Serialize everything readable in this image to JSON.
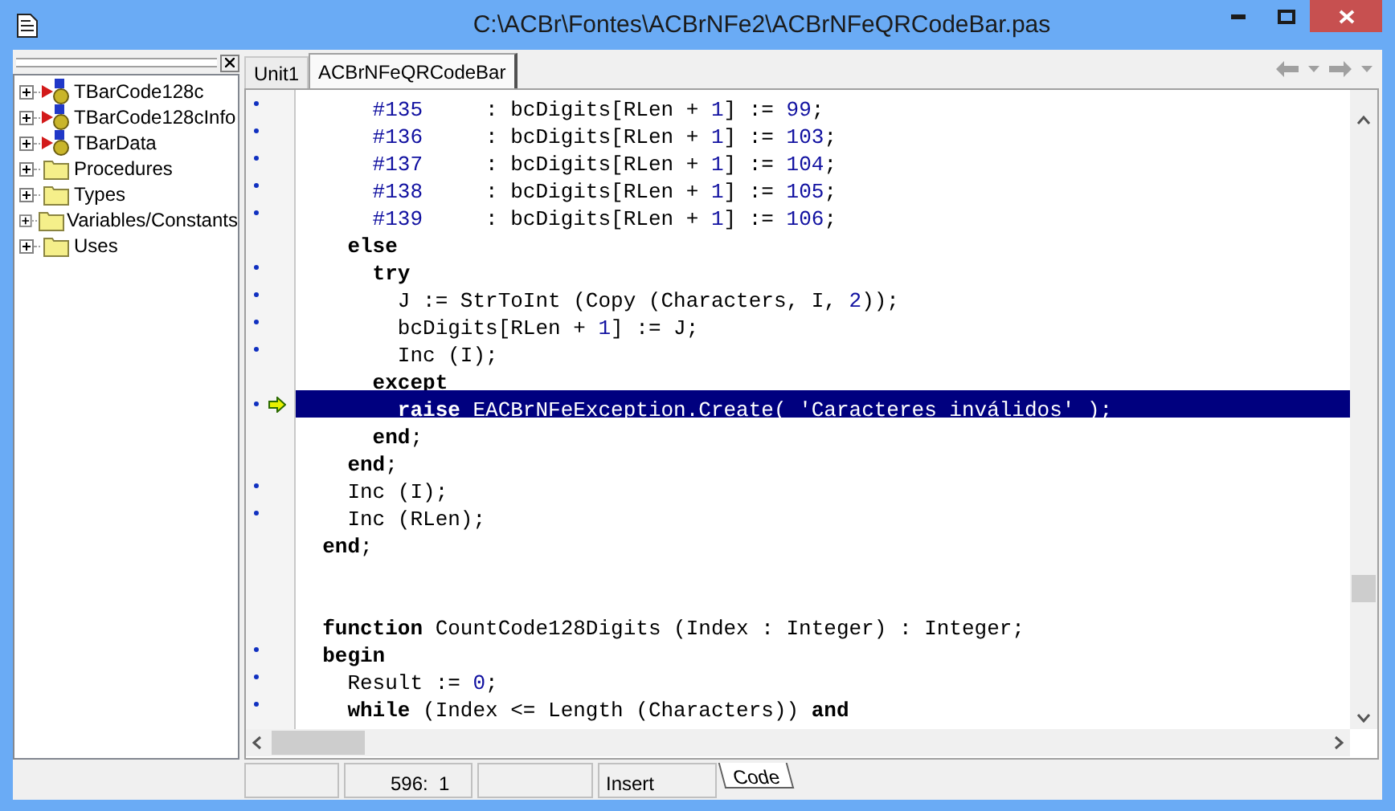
{
  "window": {
    "title": "C:\\ACBr\\Fontes\\ACBrNFe2\\ACBrNFeQRCodeBar.pas"
  },
  "explorer": {
    "items": [
      {
        "label": "TBarCode128c",
        "kind": "class",
        "expanded": false
      },
      {
        "label": "TBarCode128cInfo",
        "kind": "class",
        "expanded": false
      },
      {
        "label": "TBarData",
        "kind": "class",
        "expanded": false
      },
      {
        "label": "Procedures",
        "kind": "folder",
        "expanded": false
      },
      {
        "label": "Types",
        "kind": "folder",
        "expanded": false
      },
      {
        "label": "Variables/Constants",
        "kind": "folder",
        "expanded": false
      },
      {
        "label": "Uses",
        "kind": "folder",
        "expanded": false
      }
    ]
  },
  "tabs": [
    {
      "label": "Unit1",
      "selected": false
    },
    {
      "label": "ACBrNFeQRCodeBar",
      "selected": true
    }
  ],
  "editor": {
    "lines": [
      {
        "marker": true,
        "current": false,
        "segments": [
          {
            "text": "      #135",
            "kind": "number"
          },
          {
            "text": "     : bcDigits[RLen + ",
            "kind": "text"
          },
          {
            "text": "1",
            "kind": "number"
          },
          {
            "text": "] := ",
            "kind": "text"
          },
          {
            "text": "99",
            "kind": "number"
          },
          {
            "text": ";",
            "kind": "text"
          }
        ]
      },
      {
        "marker": true,
        "current": false,
        "segments": [
          {
            "text": "      #136",
            "kind": "number"
          },
          {
            "text": "     : bcDigits[RLen + ",
            "kind": "text"
          },
          {
            "text": "1",
            "kind": "number"
          },
          {
            "text": "] := ",
            "kind": "text"
          },
          {
            "text": "103",
            "kind": "number"
          },
          {
            "text": ";",
            "kind": "text"
          }
        ]
      },
      {
        "marker": true,
        "current": false,
        "segments": [
          {
            "text": "      #137",
            "kind": "number"
          },
          {
            "text": "     : bcDigits[RLen + ",
            "kind": "text"
          },
          {
            "text": "1",
            "kind": "number"
          },
          {
            "text": "] := ",
            "kind": "text"
          },
          {
            "text": "104",
            "kind": "number"
          },
          {
            "text": ";",
            "kind": "text"
          }
        ]
      },
      {
        "marker": true,
        "current": false,
        "segments": [
          {
            "text": "      #138",
            "kind": "number"
          },
          {
            "text": "     : bcDigits[RLen + ",
            "kind": "text"
          },
          {
            "text": "1",
            "kind": "number"
          },
          {
            "text": "] := ",
            "kind": "text"
          },
          {
            "text": "105",
            "kind": "number"
          },
          {
            "text": ";",
            "kind": "text"
          }
        ]
      },
      {
        "marker": true,
        "current": false,
        "segments": [
          {
            "text": "      #139",
            "kind": "number"
          },
          {
            "text": "     : bcDigits[RLen + ",
            "kind": "text"
          },
          {
            "text": "1",
            "kind": "number"
          },
          {
            "text": "] := ",
            "kind": "text"
          },
          {
            "text": "106",
            "kind": "number"
          },
          {
            "text": ";",
            "kind": "text"
          }
        ]
      },
      {
        "marker": false,
        "current": false,
        "segments": [
          {
            "text": "    else",
            "kind": "keyword"
          }
        ]
      },
      {
        "marker": true,
        "current": false,
        "segments": [
          {
            "text": "      try",
            "kind": "keyword"
          }
        ]
      },
      {
        "marker": true,
        "current": false,
        "segments": [
          {
            "text": "        J := StrToInt (Copy (Characters, I, ",
            "kind": "text"
          },
          {
            "text": "2",
            "kind": "number"
          },
          {
            "text": "));",
            "kind": "text"
          }
        ]
      },
      {
        "marker": true,
        "current": false,
        "segments": [
          {
            "text": "        bcDigits[RLen + ",
            "kind": "text"
          },
          {
            "text": "1",
            "kind": "number"
          },
          {
            "text": "] := J;",
            "kind": "text"
          }
        ]
      },
      {
        "marker": true,
        "current": false,
        "segments": [
          {
            "text": "        Inc (I);",
            "kind": "text"
          }
        ]
      },
      {
        "marker": false,
        "current": false,
        "segments": [
          {
            "text": "      except",
            "kind": "keyword"
          }
        ]
      },
      {
        "marker": true,
        "current": true,
        "segments": [
          {
            "text": "        raise",
            "kind": "keyword"
          },
          {
            "text": " EACBrNFeException.Create( ",
            "kind": "text"
          },
          {
            "text": "'Caracteres inválidos'",
            "kind": "string"
          },
          {
            "text": " );",
            "kind": "text"
          }
        ]
      },
      {
        "marker": false,
        "current": false,
        "segments": [
          {
            "text": "      end",
            "kind": "keyword"
          },
          {
            "text": ";",
            "kind": "text"
          }
        ]
      },
      {
        "marker": false,
        "current": false,
        "segments": [
          {
            "text": "    end",
            "kind": "keyword"
          },
          {
            "text": ";",
            "kind": "text"
          }
        ]
      },
      {
        "marker": true,
        "current": false,
        "segments": [
          {
            "text": "    Inc (I);",
            "kind": "text"
          }
        ]
      },
      {
        "marker": true,
        "current": false,
        "segments": [
          {
            "text": "    Inc (RLen);",
            "kind": "text"
          }
        ]
      },
      {
        "marker": false,
        "current": false,
        "segments": [
          {
            "text": "  end",
            "kind": "keyword"
          },
          {
            "text": ";",
            "kind": "text"
          }
        ]
      },
      {
        "marker": false,
        "current": false
      },
      {
        "marker": false,
        "current": false
      },
      {
        "marker": false,
        "current": false,
        "segments": [
          {
            "text": "  function",
            "kind": "keyword"
          },
          {
            "text": " CountCode128Digits (Index : Integer) : Integer;",
            "kind": "text"
          }
        ]
      },
      {
        "marker": true,
        "current": false,
        "segments": [
          {
            "text": "  begin",
            "kind": "keyword"
          }
        ]
      },
      {
        "marker": true,
        "current": false,
        "segments": [
          {
            "text": "    Result := ",
            "kind": "text"
          },
          {
            "text": "0",
            "kind": "number"
          },
          {
            "text": ";",
            "kind": "text"
          }
        ]
      },
      {
        "marker": true,
        "current": false,
        "segments": [
          {
            "text": "    while",
            "kind": "keyword"
          },
          {
            "text": " (Index <= Length (Characters)) ",
            "kind": "text"
          },
          {
            "text": "and",
            "kind": "keyword"
          }
        ]
      }
    ]
  },
  "status_bar": {
    "position": "596:  1",
    "mode": "Insert",
    "view_tab": "Code"
  }
}
